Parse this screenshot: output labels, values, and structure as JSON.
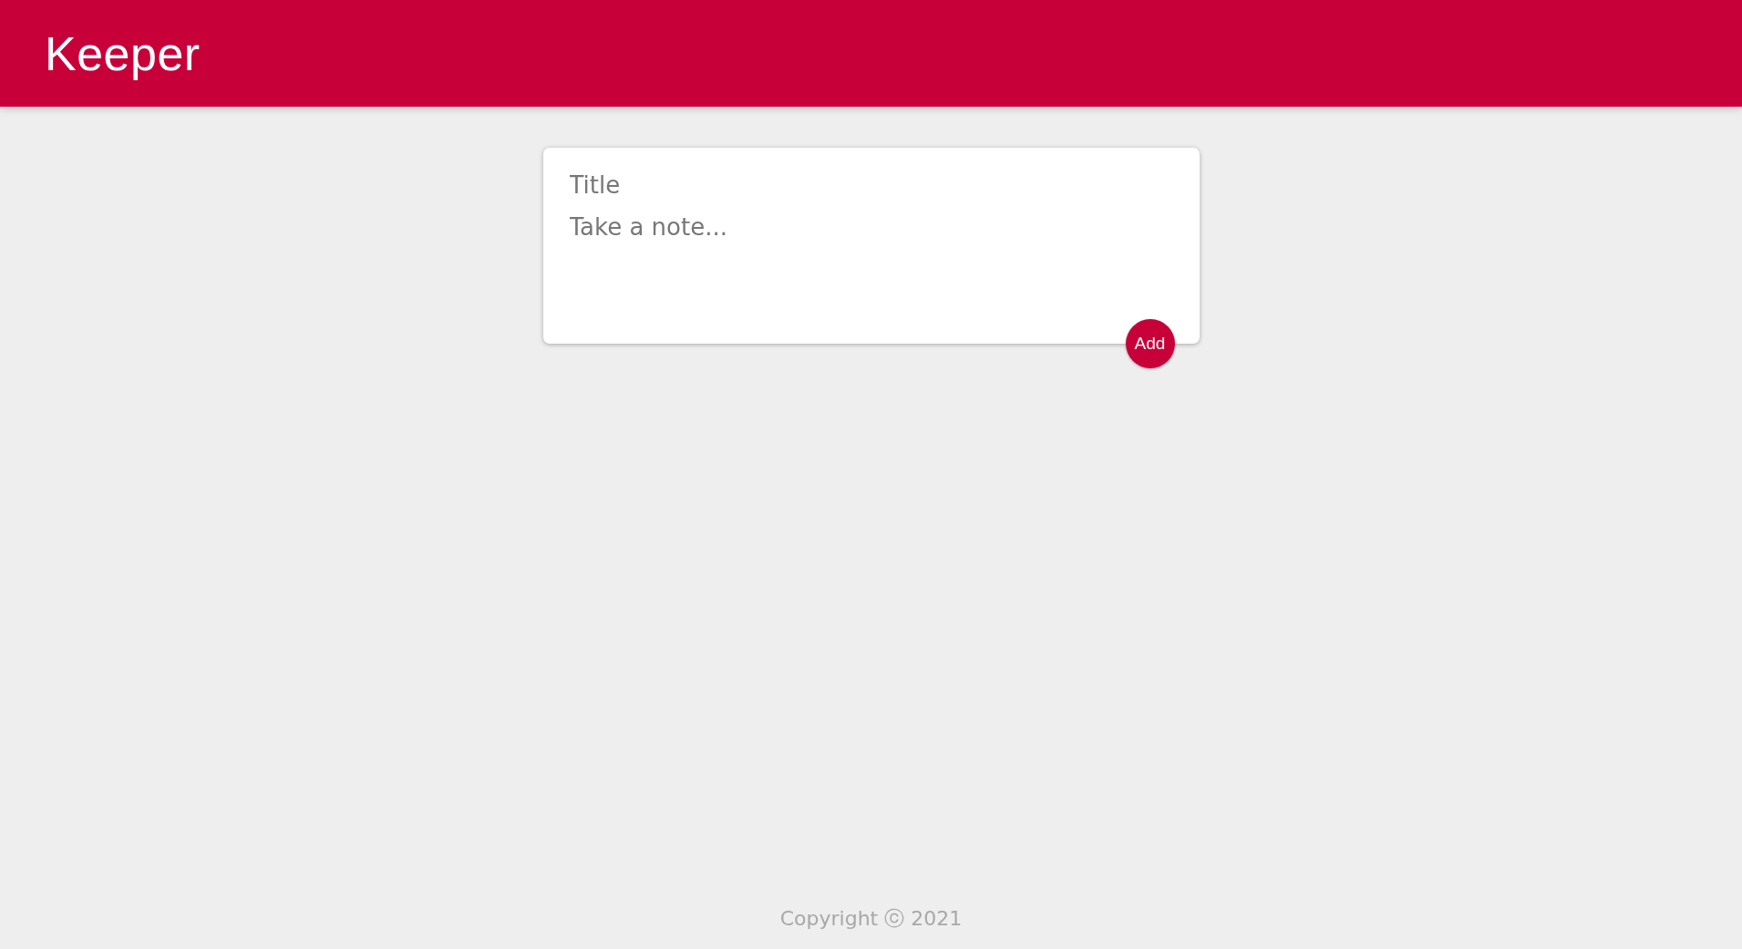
{
  "header": {
    "logo": "Keeper"
  },
  "note_form": {
    "title": {
      "placeholder": "Title"
    },
    "content": {
      "placeholder": "Take a note..."
    },
    "button": "Add"
  },
  "footer": {
    "copyright": "Copyright ⓒ 2021"
  }
}
